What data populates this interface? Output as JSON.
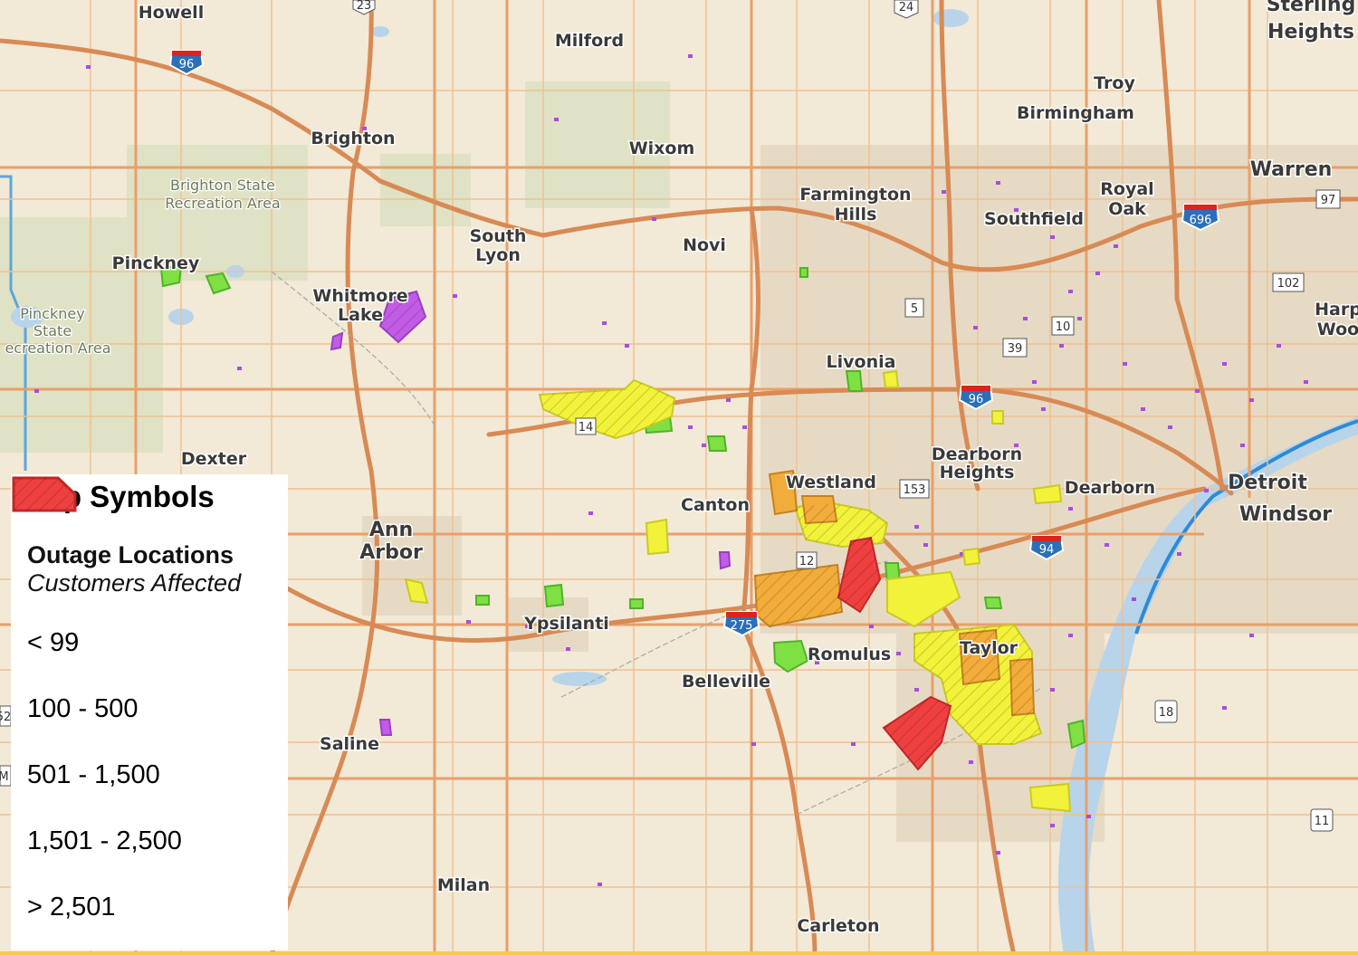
{
  "map": {
    "places": [
      {
        "id": "howell",
        "name": "Howell"
      },
      {
        "id": "milford",
        "name": "Milford"
      },
      {
        "id": "sterling",
        "name": "Sterling"
      },
      {
        "id": "heights",
        "name": "Heights"
      },
      {
        "id": "troy",
        "name": "Troy"
      },
      {
        "id": "birmingham",
        "name": "Birmingham"
      },
      {
        "id": "brighton",
        "name": "Brighton"
      },
      {
        "id": "wixom",
        "name": "Wixom"
      },
      {
        "id": "warren",
        "name": "Warren"
      },
      {
        "id": "farmington",
        "name": "Farmington"
      },
      {
        "id": "hills",
        "name": "Hills"
      },
      {
        "id": "royal",
        "name": "Royal"
      },
      {
        "id": "oak",
        "name": "Oak"
      },
      {
        "id": "southfield",
        "name": "Southfield"
      },
      {
        "id": "south",
        "name": "South"
      },
      {
        "id": "lyon",
        "name": "Lyon"
      },
      {
        "id": "novi",
        "name": "Novi"
      },
      {
        "id": "pinckney",
        "name": "Pinckney"
      },
      {
        "id": "whitmore",
        "name": "Whitmore"
      },
      {
        "id": "lake",
        "name": "Lake"
      },
      {
        "id": "harp",
        "name": "Harp"
      },
      {
        "id": "woo",
        "name": "Woo"
      },
      {
        "id": "livonia",
        "name": "Livonia"
      },
      {
        "id": "dexter",
        "name": "Dexter"
      },
      {
        "id": "dearborn1",
        "name": "Dearborn"
      },
      {
        "id": "heights2",
        "name": "Heights"
      },
      {
        "id": "westland",
        "name": "Westland"
      },
      {
        "id": "dearborn",
        "name": "Dearborn"
      },
      {
        "id": "detroit",
        "name": "Detroit"
      },
      {
        "id": "canton",
        "name": "Canton"
      },
      {
        "id": "windsor",
        "name": "Windsor"
      },
      {
        "id": "ann",
        "name": "Ann"
      },
      {
        "id": "arbor",
        "name": "Arbor"
      },
      {
        "id": "ypsilanti",
        "name": "Ypsilanti"
      },
      {
        "id": "romulus",
        "name": "Romulus"
      },
      {
        "id": "taylor",
        "name": "Taylor"
      },
      {
        "id": "belleville",
        "name": "Belleville"
      },
      {
        "id": "saline",
        "name": "Saline"
      },
      {
        "id": "milan",
        "name": "Milan"
      },
      {
        "id": "carleton",
        "name": "Carleton"
      }
    ],
    "parks": [
      {
        "id": "brighton-sra-1",
        "name": "Brighton State"
      },
      {
        "id": "brighton-sra-2",
        "name": "Recreation Area"
      },
      {
        "id": "pinckney-sra-1",
        "name": "Pinckney"
      },
      {
        "id": "pinckney-sra-2",
        "name": "State"
      },
      {
        "id": "pinckney-sra-3",
        "name": "ecreation Area"
      }
    ],
    "shields": [
      {
        "id": "i96-nw",
        "text": "96"
      },
      {
        "id": "us23",
        "text": "23"
      },
      {
        "id": "m24",
        "text": "24"
      },
      {
        "id": "i696",
        "text": "696"
      },
      {
        "id": "m97",
        "text": "97"
      },
      {
        "id": "m5",
        "text": "5"
      },
      {
        "id": "m10",
        "text": "10"
      },
      {
        "id": "m102",
        "text": "102"
      },
      {
        "id": "m39",
        "text": "39"
      },
      {
        "id": "i96-e",
        "text": "96"
      },
      {
        "id": "m153",
        "text": "153"
      },
      {
        "id": "i94",
        "text": "94"
      },
      {
        "id": "m14",
        "text": "14"
      },
      {
        "id": "m12",
        "text": "12"
      },
      {
        "id": "i275",
        "text": "275"
      },
      {
        "id": "r18",
        "text": "18"
      },
      {
        "id": "r11",
        "text": "11"
      },
      {
        "id": "edge52",
        "text": "52"
      },
      {
        "id": "edgeM",
        "text": "M"
      }
    ]
  },
  "legend": {
    "title": "Map Symbols",
    "subtitle": "Outage Locations",
    "subtitle2": "Customers Affected",
    "items": [
      {
        "label": "< 99",
        "color": "#c25ce6"
      },
      {
        "label": "100 - 500",
        "color": "#7ee043"
      },
      {
        "label": "501 - 1,500",
        "color": "#f2f23a"
      },
      {
        "label": "1,501 - 2,500",
        "color": "#f2ac3a"
      },
      {
        "label": "> 2,501",
        "color": "#ef4040"
      }
    ]
  }
}
